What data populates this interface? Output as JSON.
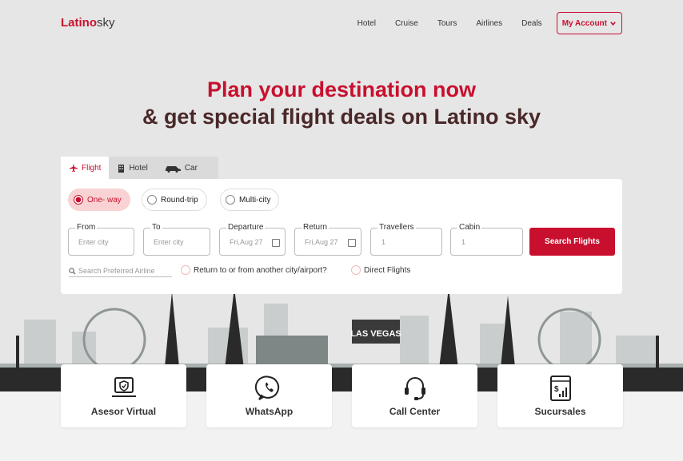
{
  "header": {
    "logo_bold": "Latino",
    "logo_rest": "sky",
    "nav": [
      "Hotel",
      "Cruise",
      "Tours",
      "Airlines",
      "Deals"
    ],
    "account_label": "My Account"
  },
  "hero": {
    "line1": "Plan your destination now",
    "line2": "& get special flight deals on Latino sky"
  },
  "tabs": [
    {
      "label": "Flight",
      "icon": "plane-icon",
      "active": true
    },
    {
      "label": "Hotel",
      "icon": "building-icon",
      "active": false
    },
    {
      "label": "Car",
      "icon": "car-icon",
      "active": false
    }
  ],
  "trip_types": [
    "One- way",
    "Round-trip",
    "Multi-city"
  ],
  "fields": {
    "from": {
      "label": "From",
      "placeholder": "Enter city"
    },
    "to": {
      "label": "To",
      "placeholder": "Enter city"
    },
    "departure": {
      "label": "Departure",
      "value": "Fri,Aug 27"
    },
    "return": {
      "label": "Return",
      "value": "Fri,Aug 27"
    },
    "travellers": {
      "label": "Travellers",
      "value": "1"
    },
    "cabin": {
      "label": "Cabin",
      "value": "1"
    }
  },
  "search_button": "Search Flights",
  "airline_placeholder": "Search Preferred Airline",
  "options": [
    "Return to or from another city/airport?",
    "Direct Flights"
  ],
  "skyline_sign": "LAS VEGAS",
  "services": [
    {
      "label": "Asesor Virtual",
      "icon": "laptop-shield-icon"
    },
    {
      "label": "WhatsApp",
      "icon": "whatsapp-icon"
    },
    {
      "label": "Call Center",
      "icon": "headset-icon"
    },
    {
      "label": "Sucursales",
      "icon": "money-window-icon"
    }
  ],
  "colors": {
    "accent": "#c8102e",
    "heading_dark": "#4a2828",
    "background": "#e6e6e6"
  }
}
